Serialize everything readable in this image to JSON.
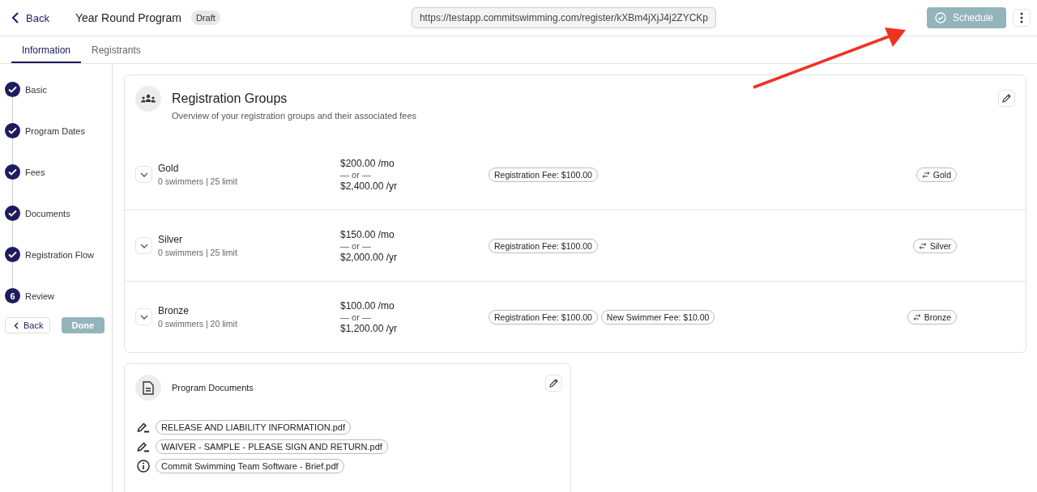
{
  "header": {
    "back": "Back",
    "title": "Year Round Program",
    "status_badge": "Draft",
    "url": "https://testapp.commitswimming.com/register/kXBm4jXjJ4j2ZYCKp",
    "schedule_button": {
      "label": "Schedule",
      "disabled": true
    }
  },
  "tabs": [
    {
      "label": "Information",
      "selected": true
    },
    {
      "label": "Registrants",
      "selected": false
    }
  ],
  "steps": [
    {
      "label": "Basic",
      "completed": true
    },
    {
      "label": "Program Dates",
      "completed": true
    },
    {
      "label": "Fees",
      "completed": true
    },
    {
      "label": "Documents",
      "completed": true
    },
    {
      "label": "Registration Flow",
      "completed": true
    },
    {
      "label": "Review",
      "completed": false,
      "number": "6"
    }
  ],
  "step_buttons": {
    "back": "Back",
    "done": {
      "label": "Done",
      "disabled": true
    }
  },
  "registration_groups": {
    "title": "Registration Groups",
    "subtitle": "Overview of your registration groups and their associated fees",
    "groups": [
      {
        "name": "Gold",
        "detail": "0 swimmers | 25 limit",
        "monthly": "$200.00 /mo",
        "or": "— or —",
        "yearly": "$2,400.00 /yr",
        "fees": [
          "Registration Fee: $100.00"
        ],
        "link": "Gold"
      },
      {
        "name": "Silver",
        "detail": "0 swimmers | 25 limit",
        "monthly": "$150.00 /mo",
        "or": "— or —",
        "yearly": "$2,000.00 /yr",
        "fees": [
          "Registration Fee: $100.00"
        ],
        "link": "Silver"
      },
      {
        "name": "Bronze",
        "detail": "0 swimmers | 20 limit",
        "monthly": "$100.00 /mo",
        "or": "— or —",
        "yearly": "$1,200.00 /yr",
        "fees": [
          "Registration Fee: $100.00",
          "New Swimmer Fee: $10.00"
        ],
        "link": "Bronze"
      }
    ]
  },
  "program_documents": {
    "title": "Program Documents",
    "documents": [
      {
        "kind": "signature",
        "name": "RELEASE AND LIABILITY INFORMATION.pdf"
      },
      {
        "kind": "signature",
        "name": "WAIVER - SAMPLE - PLEASE SIGN AND RETURN.pdf"
      },
      {
        "kind": "info",
        "name": "Commit Swimming Team Software - Brief.pdf"
      }
    ]
  }
}
